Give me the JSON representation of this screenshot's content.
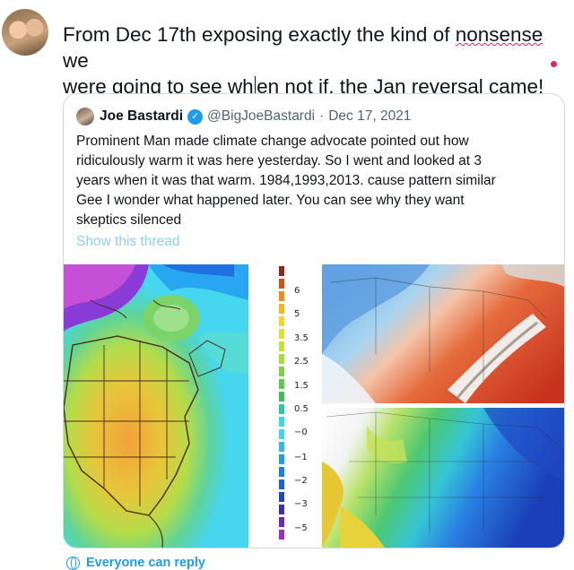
{
  "compose": {
    "line1_a": "From Dec 17th exposing exactly the kind of ",
    "line1_b": "nonsense",
    "line1_c": " we",
    "line2_a": "were going to see wh",
    "line2_b": "en not if, the Jan reversal came!"
  },
  "quoted_tweet": {
    "author_name": "Joe Bastardi",
    "handle": "@BigJoeBastardi",
    "separator": "·",
    "date": "Dec 17, 2021",
    "text": "Prominent Man made climate change advocate pointed out how\nridiculously warm it was here yesterday.   So I went and looked at 3\nyears when it was that warm. 1984,1993,2013. cause pattern similar\nGee I wonder what happened later.  You can see why they want\nskeptics silenced",
    "show_thread": "Show this thread",
    "color_scale_labels": [
      "6",
      "5",
      "3.5",
      "2.5",
      "1.5",
      "0.5",
      "−0",
      "−1",
      "−2",
      "−3",
      "−5"
    ]
  },
  "footer": {
    "reply_setting": "Everyone can reply"
  },
  "colors": {
    "accent": "#1d9bf0",
    "spellcheck": "#e0245e",
    "link_faded": "#8ecdf7"
  },
  "icons": {
    "verified": "verified-badge-icon",
    "reply_setting": "globe-icon"
  }
}
